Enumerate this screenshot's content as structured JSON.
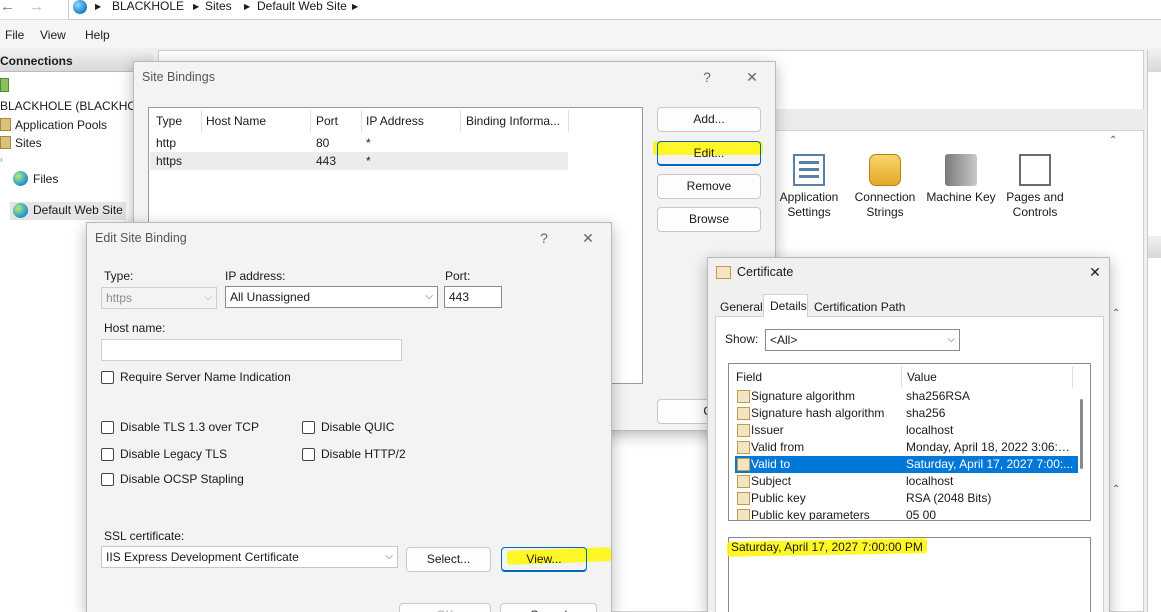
{
  "address_bar": {
    "crumbs": [
      "BLACKHOLE",
      "Sites",
      "Default Web Site"
    ]
  },
  "menu": [
    "File",
    "View",
    "Help"
  ],
  "connections": {
    "title": "Connections",
    "items": [
      "BLACKHOLE (BLACKHOLE",
      "Application Pools",
      "Sites",
      "Default Web Site",
      "Files"
    ]
  },
  "features": [
    {
      "label_line1": "Application",
      "label_line2": "Settings"
    },
    {
      "label_line1": "Connection",
      "label_line2": "Strings"
    },
    {
      "label_line1": "Machine Key",
      "label_line2": ""
    },
    {
      "label_line1": "Pages and",
      "label_line2": "Controls"
    }
  ],
  "site_bindings": {
    "title": "Site Bindings",
    "help": "?",
    "close": "✕",
    "columns": [
      "Type",
      "Host Name",
      "Port",
      "IP Address",
      "Binding Informa..."
    ],
    "rows": [
      {
        "type": "http",
        "host": "",
        "port": "80",
        "ip": "*",
        "info": ""
      },
      {
        "type": "https",
        "host": "",
        "port": "443",
        "ip": "*",
        "info": ""
      }
    ],
    "buttons": {
      "add": "Add...",
      "edit": "Edit...",
      "remove": "Remove",
      "browse": "Browse",
      "close_partial": "Cl"
    }
  },
  "edit_binding": {
    "title": "Edit Site Binding",
    "help": "?",
    "close": "✕",
    "type_label": "Type:",
    "type_value": "https",
    "ip_label": "IP address:",
    "ip_value": "All Unassigned",
    "port_label": "Port:",
    "port_value": "443",
    "host_label": "Host name:",
    "host_value": "",
    "sni": "Require Server Name Indication",
    "options": {
      "tls13": "Disable TLS 1.3 over TCP",
      "quic": "Disable QUIC",
      "legacy_tls": "Disable Legacy TLS",
      "http2": "Disable HTTP/2",
      "ocsp": "Disable OCSP Stapling"
    },
    "ssl_label": "SSL certificate:",
    "ssl_value": "IIS Express Development Certificate",
    "select_button": "Select...",
    "view_button": "View...",
    "ok_button": "OK",
    "cancel_button": "Cancel"
  },
  "certificate": {
    "title": "Certificate",
    "close": "✕",
    "tabs": [
      "General",
      "Details",
      "Certification Path"
    ],
    "active_tab": "Details",
    "show_label": "Show:",
    "show_value": "<All>",
    "columns": [
      "Field",
      "Value"
    ],
    "rows": [
      {
        "field": "Signature algorithm",
        "value": "sha256RSA"
      },
      {
        "field": "Signature hash algorithm",
        "value": "sha256"
      },
      {
        "field": "Issuer",
        "value": "localhost"
      },
      {
        "field": "Valid from",
        "value": "Monday, April 18, 2022 3:06:4..."
      },
      {
        "field": "Valid to",
        "value": "Saturday, April 17, 2027 7:00:..."
      },
      {
        "field": "Subject",
        "value": "localhost"
      },
      {
        "field": "Public key",
        "value": "RSA (2048 Bits)"
      },
      {
        "field": "Public key parameters",
        "value": "05 00"
      }
    ],
    "selected_row": 4,
    "detail_text": "Saturday, April 17, 2027 7:00:00 PM"
  },
  "colors": {
    "highlight": "#fff600",
    "selection": "#0078d7",
    "accent_border": "#0067c0"
  }
}
